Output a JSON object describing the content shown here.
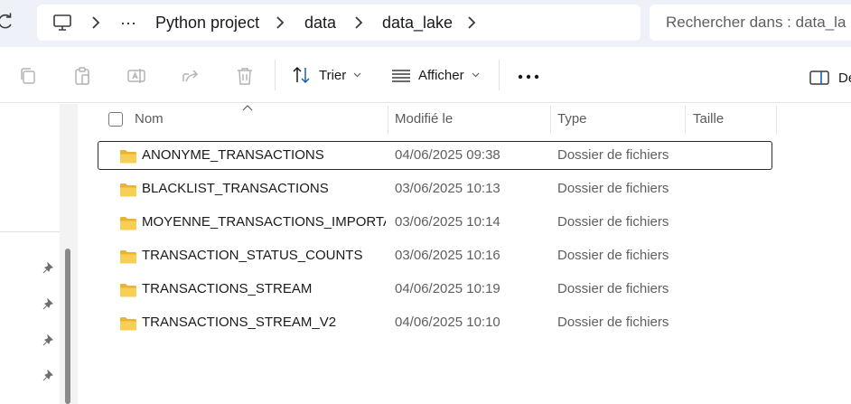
{
  "address_bar": {
    "breadcrumb": {
      "overflow_label": "···",
      "items": [
        "Python project",
        "data",
        "data_lake"
      ]
    },
    "search": {
      "placeholder": "Rechercher dans : data_la"
    }
  },
  "toolbar": {
    "sort_label": "Trier",
    "view_label": "Afficher",
    "more_label": "···",
    "details_label": "Dé"
  },
  "file_list": {
    "columns": {
      "name": "Nom",
      "modified": "Modifié le",
      "type": "Type",
      "size": "Taille"
    },
    "rows": [
      {
        "name": "ANONYME_TRANSACTIONS",
        "modified": "04/06/2025 09:38",
        "type": "Dossier de fichiers",
        "size": ""
      },
      {
        "name": "BLACKLIST_TRANSACTIONS",
        "modified": "03/06/2025 10:13",
        "type": "Dossier de fichiers",
        "size": ""
      },
      {
        "name": "MOYENNE_TRANSACTIONS_IMPORTA...",
        "modified": "03/06/2025 10:14",
        "type": "Dossier de fichiers",
        "size": ""
      },
      {
        "name": "TRANSACTION_STATUS_COUNTS",
        "modified": "03/06/2025 10:16",
        "type": "Dossier de fichiers",
        "size": ""
      },
      {
        "name": "TRANSACTIONS_STREAM",
        "modified": "04/06/2025 10:19",
        "type": "Dossier de fichiers",
        "size": ""
      },
      {
        "name": "TRANSACTIONS_STREAM_V2",
        "modified": "04/06/2025 10:10",
        "type": "Dossier de fichiers",
        "size": ""
      }
    ]
  },
  "colors": {
    "folder_yellow": "#f5c542",
    "chrome_bg": "#eef1f7",
    "accent_blue": "#1a5fb4"
  },
  "icons": [
    "refresh-icon",
    "computer-icon",
    "chevron-right-icon",
    "copy-icon",
    "paste-icon",
    "rename-icon",
    "share-icon",
    "delete-icon",
    "sort-icon",
    "view-icon",
    "chevron-down-icon",
    "more-icon",
    "details-pane-icon",
    "pin-icon",
    "folder-icon"
  ]
}
